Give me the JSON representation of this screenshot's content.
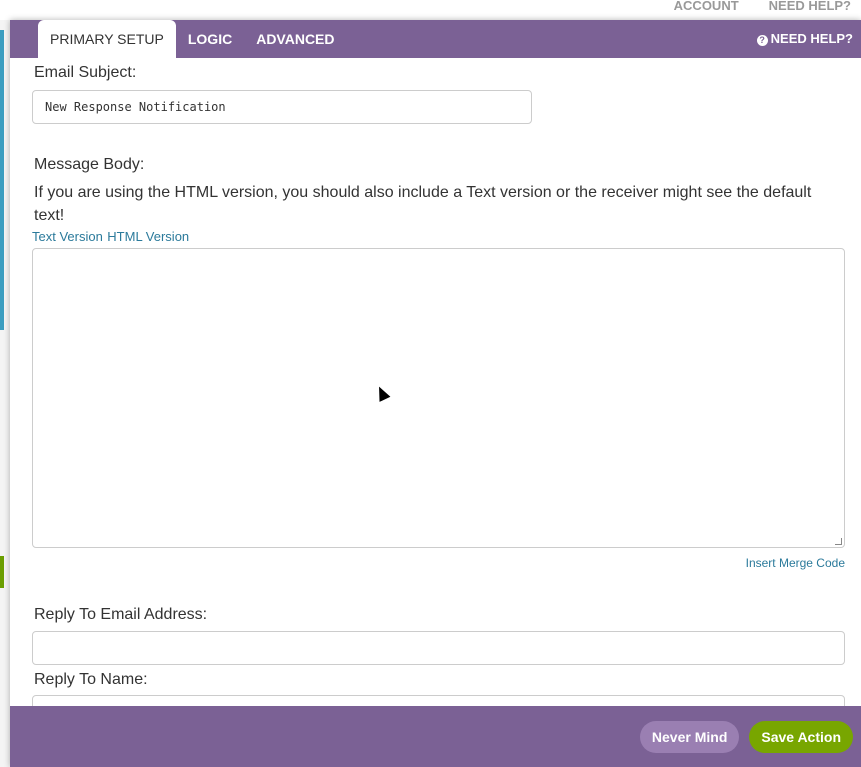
{
  "background": {
    "nav": [
      "ACCOUNT",
      "NEED HELP?"
    ]
  },
  "tabs": [
    {
      "label": "PRIMARY SETUP",
      "active": true
    },
    {
      "label": "LOGIC",
      "active": false
    },
    {
      "label": "ADVANCED",
      "active": false
    }
  ],
  "help_label": "NEED HELP?",
  "help_icon": "question-circle-icon",
  "form": {
    "email_subject_label": "Email Subject:",
    "email_subject_value": "New Response Notification",
    "message_body_label": "Message Body:",
    "message_note": "If you are using the HTML version, you should also include a Text version or the receiver might see the default text!",
    "text_version_link": "Text Version",
    "html_version_link": "HTML Version",
    "message_body_value": "",
    "insert_merge_code": "Insert Merge Code",
    "reply_email_label": "Reply To Email Address:",
    "reply_email_value": "",
    "reply_name_label": "Reply To Name:"
  },
  "footer": {
    "never_mind": "Never Mind",
    "save_action": "Save Action"
  },
  "colors": {
    "header": "#7b6195",
    "save": "#78a600",
    "never_mind": "#9a7fb2",
    "link": "#2b7a9b"
  }
}
